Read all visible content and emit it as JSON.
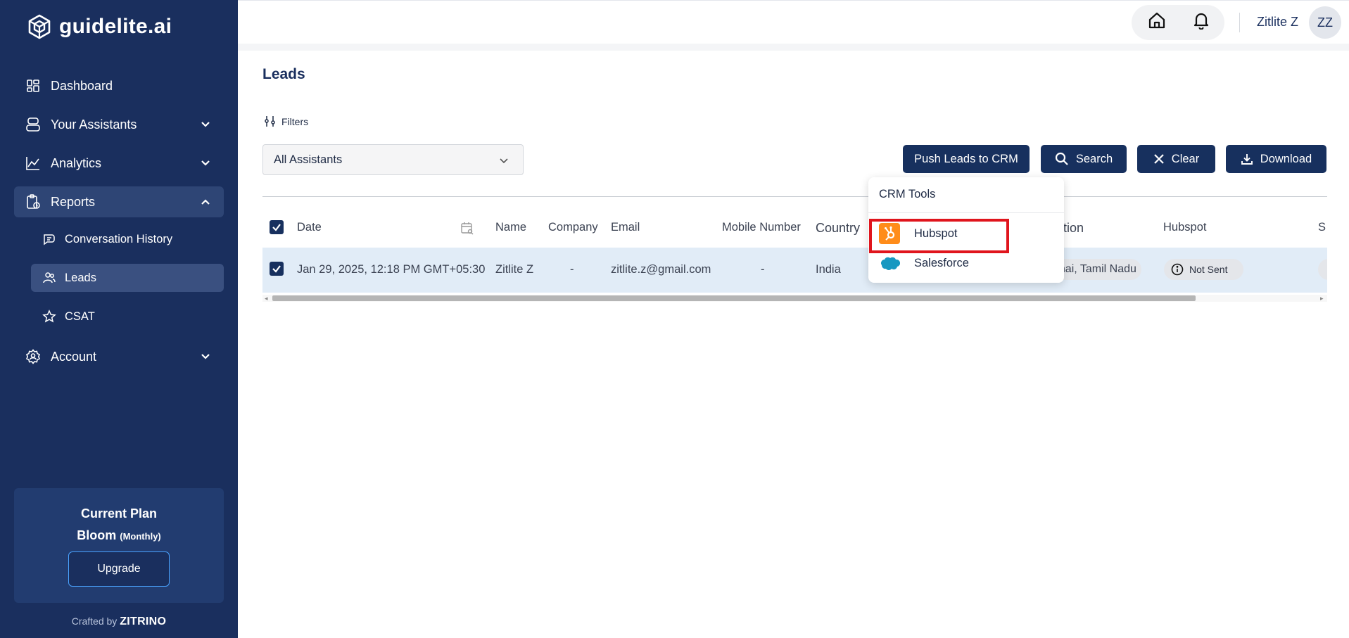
{
  "brand": {
    "name": "guidelite.ai"
  },
  "sidebar": {
    "items": [
      {
        "label": "Dashboard",
        "icon": "dashboard-icon"
      },
      {
        "label": "Your Assistants",
        "icon": "assistant-icon"
      },
      {
        "label": "Analytics",
        "icon": "analytics-icon"
      },
      {
        "label": "Reports",
        "icon": "reports-icon"
      },
      {
        "label": "Account",
        "icon": "account-icon"
      }
    ],
    "reports_sub": [
      {
        "label": "Conversation History",
        "icon": "chat-icon"
      },
      {
        "label": "Leads",
        "icon": "users-icon"
      },
      {
        "label": "CSAT",
        "icon": "star-icon"
      }
    ],
    "plan": {
      "title": "Current Plan",
      "name": "Bloom",
      "cycle": "(Monthly)",
      "upgrade_label": "Upgrade"
    },
    "crafted_by": "Crafted by",
    "crafted_brand": "ZITRINO"
  },
  "header": {
    "username": "Zitlite Z",
    "initials": "ZZ"
  },
  "page": {
    "title": "Leads",
    "filters_label": "Filters",
    "assistant_select": "All Assistants",
    "buttons": {
      "push": "Push Leads to CRM",
      "search": "Search",
      "clear": "Clear",
      "download": "Download"
    }
  },
  "table": {
    "columns": [
      "Date",
      "Name",
      "Company",
      "Email",
      "Mobile Number",
      "Country",
      "tion",
      "Hubspot",
      "S"
    ],
    "rows": [
      {
        "date": "Jan 29, 2025, 12:18 PM GMT+05:30",
        "name": "Zitlite Z",
        "company": "-",
        "email": "zitlite.z@gmail.com",
        "mobile": "-",
        "country": "India",
        "location": "nnai, Tamil Nadu",
        "hubspot": "Not Sent"
      }
    ]
  },
  "crm_menu": {
    "title": "CRM Tools",
    "items": [
      {
        "label": "Hubspot",
        "icon": "hubspot-icon",
        "color": "#ff8c1a"
      },
      {
        "label": "Salesforce",
        "icon": "salesforce-icon",
        "color": "#1798c1"
      }
    ]
  },
  "colors": {
    "sidebar": "#1a2f5e",
    "primary_button": "#17305e",
    "row_selected": "#e1ecf7",
    "highlight": "#e0151d"
  }
}
